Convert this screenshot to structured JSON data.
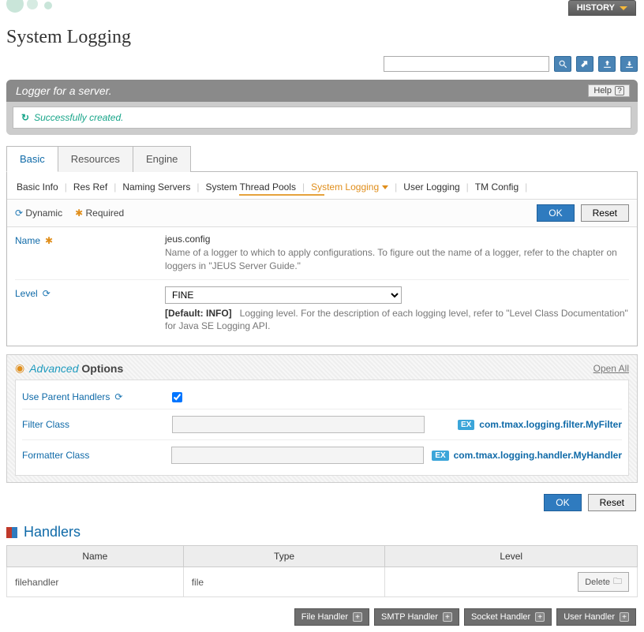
{
  "header": {
    "history_label": "HISTORY",
    "page_title": "System Logging",
    "search_placeholder": ""
  },
  "banner": {
    "title": "Logger for a server.",
    "help_label": "Help",
    "success_message": "Successfully created."
  },
  "tabs": {
    "items": [
      {
        "label": "Basic"
      },
      {
        "label": "Resources"
      },
      {
        "label": "Engine"
      }
    ],
    "active_index": 0
  },
  "subnav": {
    "items": [
      {
        "label": "Basic Info"
      },
      {
        "label": "Res Ref"
      },
      {
        "label": "Naming Servers"
      },
      {
        "label": "System Thread Pools"
      },
      {
        "label": "System Logging",
        "active": true,
        "dropdown": true
      },
      {
        "label": "User Logging"
      },
      {
        "label": "TM Config"
      }
    ]
  },
  "legend": {
    "dynamic_label": "Dynamic",
    "required_label": "Required",
    "ok_label": "OK",
    "reset_label": "Reset"
  },
  "form": {
    "name": {
      "label": "Name",
      "value": "jeus.config",
      "hint": "Name of a logger to which to apply configurations. To figure out the name of a logger, refer to the chapter on loggers in \"JEUS Server Guide.\""
    },
    "level": {
      "label": "Level",
      "value": "FINE",
      "default_label": "[Default: INFO]",
      "hint": "Logging level. For the description of each logging level, refer to \"Level Class Documentation\" for Java SE Logging API."
    }
  },
  "advanced": {
    "title_em": "Advanced",
    "title_rest": "Options",
    "open_all": "Open All",
    "use_parent_handlers": {
      "label": "Use Parent Handlers",
      "checked": true
    },
    "filter_class": {
      "label": "Filter Class",
      "example": "com.tmax.logging.filter.MyFilter"
    },
    "formatter_class": {
      "label": "Formatter Class",
      "example": "com.tmax.logging.handler.MyHandler"
    },
    "ex_badge": "EX"
  },
  "bottom_buttons": {
    "ok": "OK",
    "reset": "Reset"
  },
  "handlers": {
    "title": "Handlers",
    "columns": {
      "name": "Name",
      "type": "Type",
      "level": "Level"
    },
    "rows": [
      {
        "name": "filehandler",
        "type": "file",
        "level": ""
      }
    ],
    "delete_label": "Delete"
  },
  "footer": {
    "file_handler": "File Handler",
    "smtp_handler": "SMTP Handler",
    "socket_handler": "Socket Handler",
    "user_handler": "User Handler"
  }
}
